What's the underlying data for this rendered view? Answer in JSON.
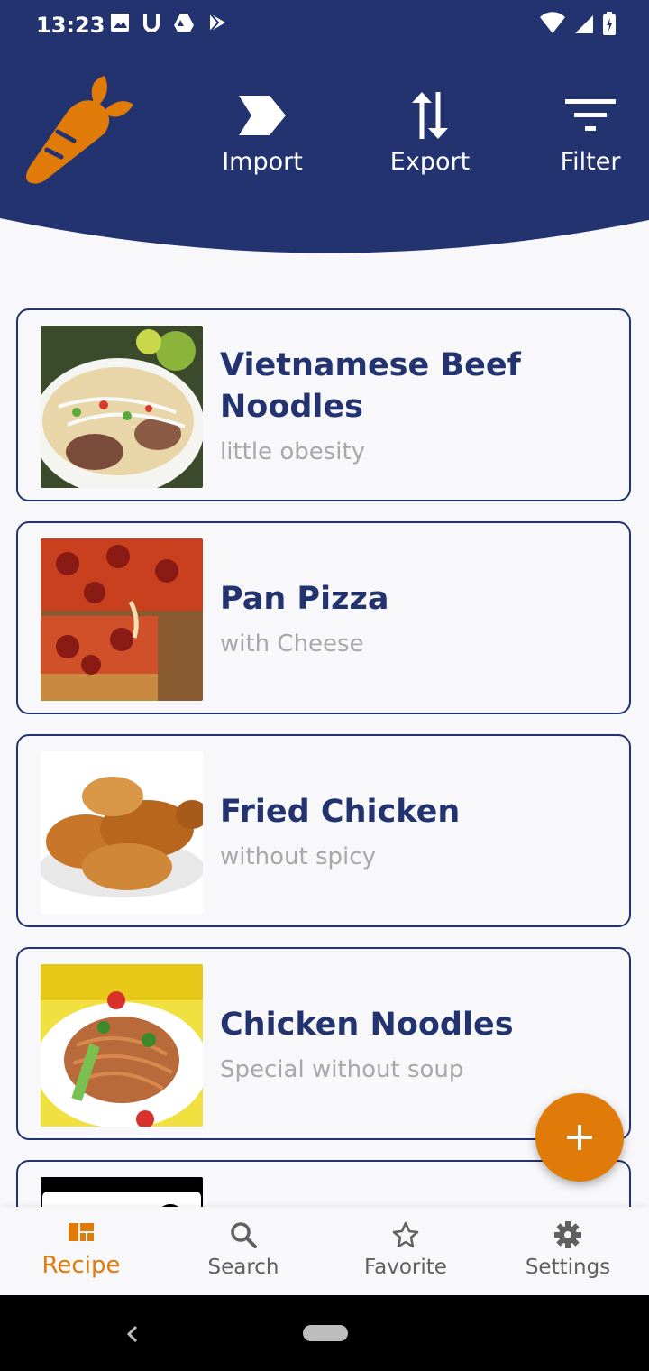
{
  "status_bar": {
    "time": "13:23"
  },
  "header": {
    "actions": [
      {
        "label": "Import",
        "icon": "import-icon"
      },
      {
        "label": "Export",
        "icon": "export-icon"
      },
      {
        "label": "Filter",
        "icon": "filter-icon"
      }
    ],
    "colors": {
      "primary": "#233370",
      "accent": "#e07b0a"
    }
  },
  "recipes": [
    {
      "title": "Vietnamese Beef Noodles",
      "subtitle": "little obesity"
    },
    {
      "title": "Pan Pizza",
      "subtitle": "with Cheese"
    },
    {
      "title": "Fried Chicken",
      "subtitle": "without spicy"
    },
    {
      "title": "Chicken Noodles",
      "subtitle": "Special without soup"
    }
  ],
  "bottom_nav": {
    "items": [
      {
        "label": "Recipe",
        "icon": "recipe-icon",
        "active": true
      },
      {
        "label": "Search",
        "icon": "search-icon",
        "active": false
      },
      {
        "label": "Favorite",
        "icon": "star-icon",
        "active": false
      },
      {
        "label": "Settings",
        "icon": "gear-icon",
        "active": false
      }
    ]
  }
}
